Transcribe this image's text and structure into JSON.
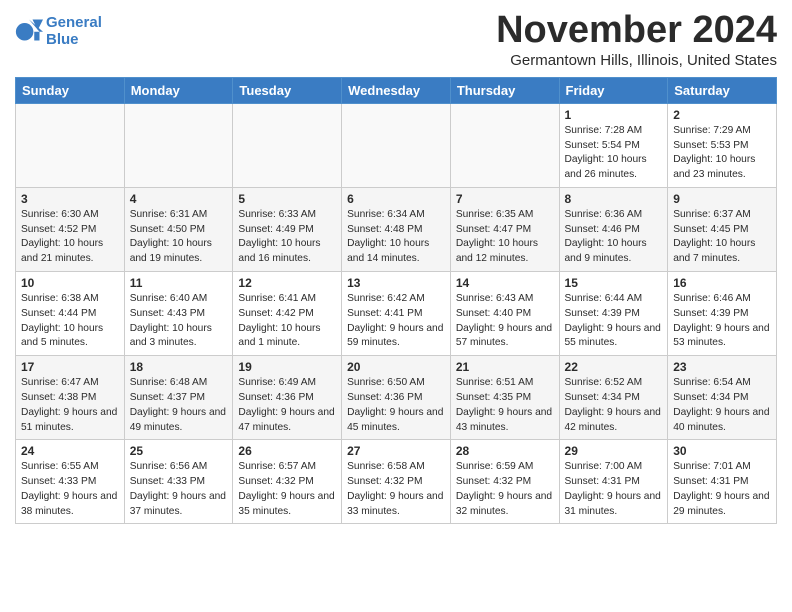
{
  "logo": {
    "line1": "General",
    "line2": "Blue"
  },
  "title": "November 2024",
  "subtitle": "Germantown Hills, Illinois, United States",
  "days_of_week": [
    "Sunday",
    "Monday",
    "Tuesday",
    "Wednesday",
    "Thursday",
    "Friday",
    "Saturday"
  ],
  "weeks": [
    [
      {
        "day": "",
        "info": ""
      },
      {
        "day": "",
        "info": ""
      },
      {
        "day": "",
        "info": ""
      },
      {
        "day": "",
        "info": ""
      },
      {
        "day": "",
        "info": ""
      },
      {
        "day": "1",
        "info": "Sunrise: 7:28 AM\nSunset: 5:54 PM\nDaylight: 10 hours and 26 minutes."
      },
      {
        "day": "2",
        "info": "Sunrise: 7:29 AM\nSunset: 5:53 PM\nDaylight: 10 hours and 23 minutes."
      }
    ],
    [
      {
        "day": "3",
        "info": "Sunrise: 6:30 AM\nSunset: 4:52 PM\nDaylight: 10 hours and 21 minutes."
      },
      {
        "day": "4",
        "info": "Sunrise: 6:31 AM\nSunset: 4:50 PM\nDaylight: 10 hours and 19 minutes."
      },
      {
        "day": "5",
        "info": "Sunrise: 6:33 AM\nSunset: 4:49 PM\nDaylight: 10 hours and 16 minutes."
      },
      {
        "day": "6",
        "info": "Sunrise: 6:34 AM\nSunset: 4:48 PM\nDaylight: 10 hours and 14 minutes."
      },
      {
        "day": "7",
        "info": "Sunrise: 6:35 AM\nSunset: 4:47 PM\nDaylight: 10 hours and 12 minutes."
      },
      {
        "day": "8",
        "info": "Sunrise: 6:36 AM\nSunset: 4:46 PM\nDaylight: 10 hours and 9 minutes."
      },
      {
        "day": "9",
        "info": "Sunrise: 6:37 AM\nSunset: 4:45 PM\nDaylight: 10 hours and 7 minutes."
      }
    ],
    [
      {
        "day": "10",
        "info": "Sunrise: 6:38 AM\nSunset: 4:44 PM\nDaylight: 10 hours and 5 minutes."
      },
      {
        "day": "11",
        "info": "Sunrise: 6:40 AM\nSunset: 4:43 PM\nDaylight: 10 hours and 3 minutes."
      },
      {
        "day": "12",
        "info": "Sunrise: 6:41 AM\nSunset: 4:42 PM\nDaylight: 10 hours and 1 minute."
      },
      {
        "day": "13",
        "info": "Sunrise: 6:42 AM\nSunset: 4:41 PM\nDaylight: 9 hours and 59 minutes."
      },
      {
        "day": "14",
        "info": "Sunrise: 6:43 AM\nSunset: 4:40 PM\nDaylight: 9 hours and 57 minutes."
      },
      {
        "day": "15",
        "info": "Sunrise: 6:44 AM\nSunset: 4:39 PM\nDaylight: 9 hours and 55 minutes."
      },
      {
        "day": "16",
        "info": "Sunrise: 6:46 AM\nSunset: 4:39 PM\nDaylight: 9 hours and 53 minutes."
      }
    ],
    [
      {
        "day": "17",
        "info": "Sunrise: 6:47 AM\nSunset: 4:38 PM\nDaylight: 9 hours and 51 minutes."
      },
      {
        "day": "18",
        "info": "Sunrise: 6:48 AM\nSunset: 4:37 PM\nDaylight: 9 hours and 49 minutes."
      },
      {
        "day": "19",
        "info": "Sunrise: 6:49 AM\nSunset: 4:36 PM\nDaylight: 9 hours and 47 minutes."
      },
      {
        "day": "20",
        "info": "Sunrise: 6:50 AM\nSunset: 4:36 PM\nDaylight: 9 hours and 45 minutes."
      },
      {
        "day": "21",
        "info": "Sunrise: 6:51 AM\nSunset: 4:35 PM\nDaylight: 9 hours and 43 minutes."
      },
      {
        "day": "22",
        "info": "Sunrise: 6:52 AM\nSunset: 4:34 PM\nDaylight: 9 hours and 42 minutes."
      },
      {
        "day": "23",
        "info": "Sunrise: 6:54 AM\nSunset: 4:34 PM\nDaylight: 9 hours and 40 minutes."
      }
    ],
    [
      {
        "day": "24",
        "info": "Sunrise: 6:55 AM\nSunset: 4:33 PM\nDaylight: 9 hours and 38 minutes."
      },
      {
        "day": "25",
        "info": "Sunrise: 6:56 AM\nSunset: 4:33 PM\nDaylight: 9 hours and 37 minutes."
      },
      {
        "day": "26",
        "info": "Sunrise: 6:57 AM\nSunset: 4:32 PM\nDaylight: 9 hours and 35 minutes."
      },
      {
        "day": "27",
        "info": "Sunrise: 6:58 AM\nSunset: 4:32 PM\nDaylight: 9 hours and 33 minutes."
      },
      {
        "day": "28",
        "info": "Sunrise: 6:59 AM\nSunset: 4:32 PM\nDaylight: 9 hours and 32 minutes."
      },
      {
        "day": "29",
        "info": "Sunrise: 7:00 AM\nSunset: 4:31 PM\nDaylight: 9 hours and 31 minutes."
      },
      {
        "day": "30",
        "info": "Sunrise: 7:01 AM\nSunset: 4:31 PM\nDaylight: 9 hours and 29 minutes."
      }
    ]
  ]
}
